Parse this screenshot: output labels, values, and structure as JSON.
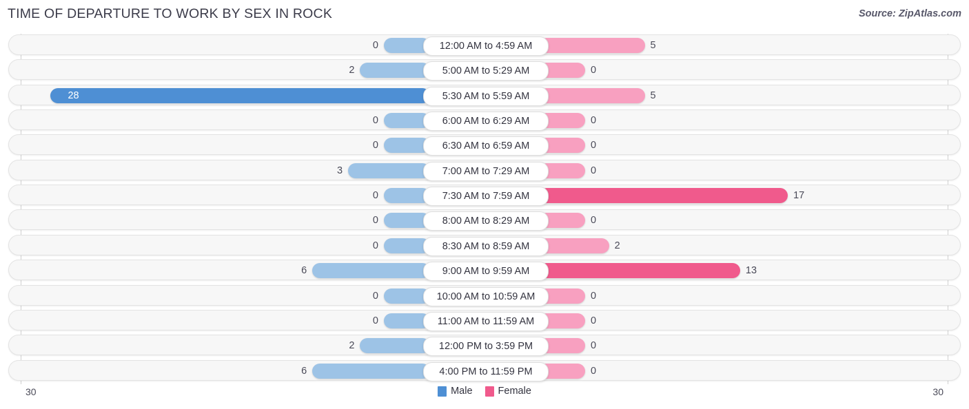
{
  "header": {
    "title": "TIME OF DEPARTURE TO WORK BY SEX IN ROCK",
    "source": "Source: ZipAtlas.com"
  },
  "footer": {
    "axis_end_left": "30",
    "axis_end_right": "30"
  },
  "colors": {
    "male": "#4e8fd4",
    "male_light": "#9dc3e6",
    "female": "#f05a8c",
    "female_light": "#f8a0c0",
    "track": "#f7f7f7",
    "track_border": "#e3e3e3",
    "axis": "#d0d0d0",
    "title": "#3c3c4a"
  },
  "chart_data": {
    "type": "bar",
    "subtype": "diverging-bidirectional-bar",
    "title": "TIME OF DEPARTURE TO WORK BY SEX IN ROCK",
    "xlabel": "",
    "ylabel": "",
    "xlim": [
      30,
      30
    ],
    "axis_max_left": 30,
    "axis_max_right": 30,
    "grid": false,
    "legend_position": "bottom-center",
    "categories": [
      "12:00 AM to 4:59 AM",
      "5:00 AM to 5:29 AM",
      "5:30 AM to 5:59 AM",
      "6:00 AM to 6:29 AM",
      "6:30 AM to 6:59 AM",
      "7:00 AM to 7:29 AM",
      "7:30 AM to 7:59 AM",
      "8:00 AM to 8:29 AM",
      "8:30 AM to 8:59 AM",
      "9:00 AM to 9:59 AM",
      "10:00 AM to 10:59 AM",
      "11:00 AM to 11:59 AM",
      "12:00 PM to 3:59 PM",
      "4:00 PM to 11:59 PM"
    ],
    "series": [
      {
        "name": "Male",
        "color": "#4e8fd4",
        "direction": "left",
        "values": [
          0,
          2,
          28,
          0,
          0,
          3,
          0,
          0,
          0,
          6,
          0,
          0,
          2,
          6
        ]
      },
      {
        "name": "Female",
        "color": "#f05a8c",
        "direction": "right",
        "values": [
          5,
          0,
          5,
          0,
          0,
          0,
          17,
          0,
          2,
          13,
          0,
          0,
          0,
          0
        ]
      }
    ]
  },
  "legend": [
    {
      "label": "Male",
      "color": "#4e8fd4"
    },
    {
      "label": "Female",
      "color": "#f05a8c"
    }
  ]
}
